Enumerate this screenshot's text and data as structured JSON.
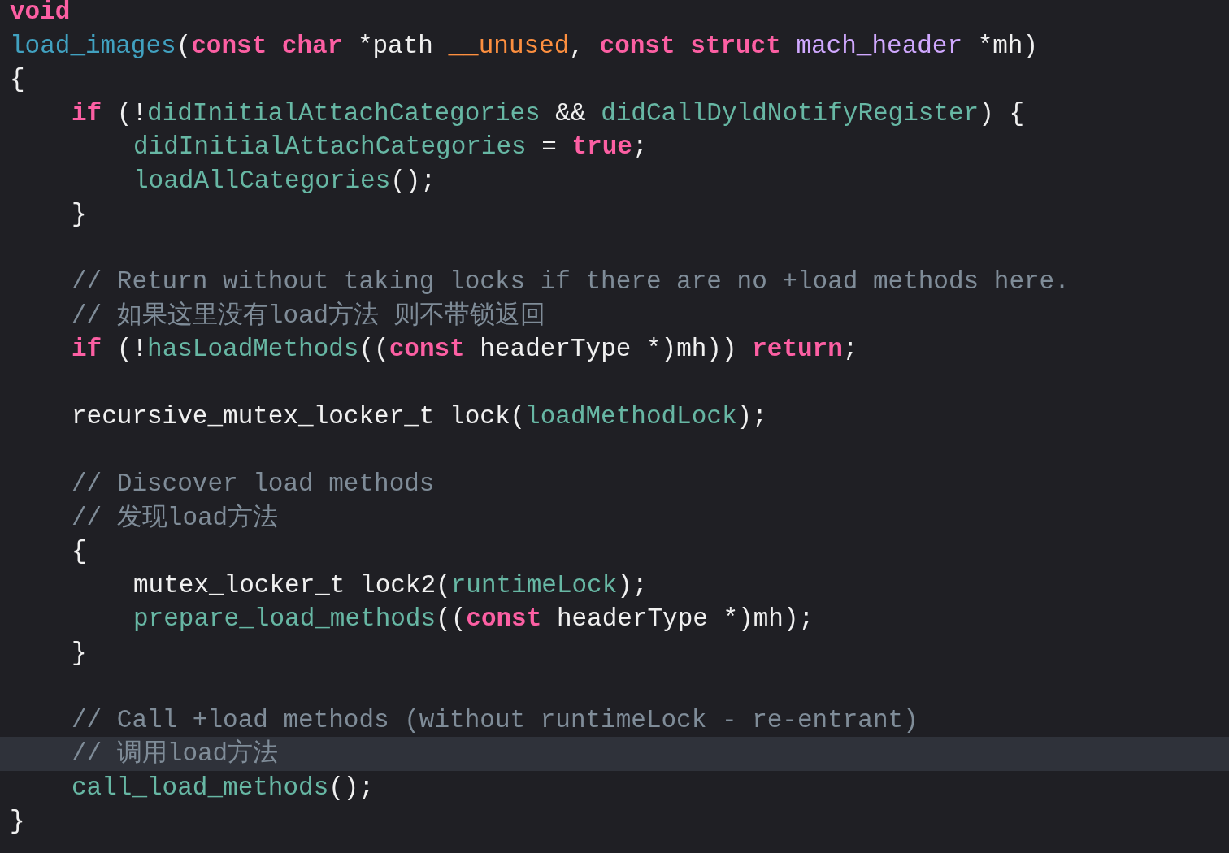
{
  "editor": {
    "lines": [
      {
        "kind": "code",
        "tokens": [
          {
            "text": "void",
            "kind": "keyword"
          }
        ]
      },
      {
        "kind": "code",
        "tokens": [
          {
            "text": "load_images",
            "kind": "declaration"
          },
          {
            "text": "(",
            "kind": "plain"
          },
          {
            "text": "const char",
            "kind": "keyword"
          },
          {
            "text": " *path ",
            "kind": "plain"
          },
          {
            "text": "__unused",
            "kind": "macro"
          },
          {
            "text": ", ",
            "kind": "plain"
          },
          {
            "text": "const struct ",
            "kind": "keyword"
          },
          {
            "text": "mach_header",
            "kind": "type"
          },
          {
            "text": " *mh)",
            "kind": "plain"
          }
        ]
      },
      {
        "kind": "code",
        "tokens": [
          {
            "text": "{",
            "kind": "plain"
          }
        ],
        "children": [
          {
            "kind": "code",
            "tokens": [
              {
                "text": "if",
                "kind": "keyword"
              },
              {
                "text": " (!",
                "kind": "plain"
              },
              {
                "text": "didInitialAttachCategories",
                "kind": "identifier"
              },
              {
                "text": " && ",
                "kind": "plain"
              },
              {
                "text": "didCallDyldNotifyRegister",
                "kind": "identifier"
              },
              {
                "text": ") {",
                "kind": "plain"
              }
            ],
            "children": [
              {
                "kind": "code",
                "tokens": [
                  {
                    "text": "didInitialAttachCategories",
                    "kind": "identifier"
                  },
                  {
                    "text": " = ",
                    "kind": "plain"
                  },
                  {
                    "text": "true",
                    "kind": "keyword"
                  },
                  {
                    "text": ";",
                    "kind": "plain"
                  }
                ]
              },
              {
                "kind": "code",
                "tokens": [
                  {
                    "text": "loadAllCategories",
                    "kind": "identifier"
                  },
                  {
                    "text": "();",
                    "kind": "plain"
                  }
                ]
              }
            ]
          },
          {
            "kind": "code",
            "tokens": [
              {
                "text": "}",
                "kind": "plain"
              }
            ]
          },
          {
            "kind": "blank"
          },
          {
            "kind": "code",
            "tokens": [
              {
                "text": "// Return without taking locks if there are no +load methods here.",
                "kind": "comment"
              }
            ]
          },
          {
            "kind": "code",
            "tokens": [
              {
                "text": "// 如果这里没有load方法 则不带锁返回",
                "kind": "comment"
              }
            ]
          },
          {
            "kind": "code",
            "tokens": [
              {
                "text": "if",
                "kind": "keyword"
              },
              {
                "text": " (!",
                "kind": "plain"
              },
              {
                "text": "hasLoadMethods",
                "kind": "identifier"
              },
              {
                "text": "((",
                "kind": "plain"
              },
              {
                "text": "const",
                "kind": "keyword"
              },
              {
                "text": " headerType *)mh)) ",
                "kind": "plain"
              },
              {
                "text": "return",
                "kind": "keyword"
              },
              {
                "text": ";",
                "kind": "plain"
              }
            ]
          },
          {
            "kind": "blank"
          },
          {
            "kind": "code",
            "tokens": [
              {
                "text": "recursive_mutex_locker_t lock(",
                "kind": "plain"
              },
              {
                "text": "loadMethodLock",
                "kind": "identifier"
              },
              {
                "text": ");",
                "kind": "plain"
              }
            ]
          },
          {
            "kind": "blank"
          },
          {
            "kind": "code",
            "tokens": [
              {
                "text": "// Discover load methods",
                "kind": "comment"
              }
            ]
          },
          {
            "kind": "code",
            "tokens": [
              {
                "text": "// 发现load方法",
                "kind": "comment"
              }
            ]
          },
          {
            "kind": "code",
            "tokens": [
              {
                "text": "{",
                "kind": "plain"
              }
            ],
            "children": [
              {
                "kind": "code",
                "tokens": [
                  {
                    "text": "mutex_locker_t lock2(",
                    "kind": "plain"
                  },
                  {
                    "text": "runtimeLock",
                    "kind": "identifier"
                  },
                  {
                    "text": ");",
                    "kind": "plain"
                  }
                ]
              },
              {
                "kind": "code",
                "tokens": [
                  {
                    "text": "prepare_load_methods",
                    "kind": "identifier"
                  },
                  {
                    "text": "((",
                    "kind": "plain"
                  },
                  {
                    "text": "const",
                    "kind": "keyword"
                  },
                  {
                    "text": " headerType *)mh);",
                    "kind": "plain"
                  }
                ]
              }
            ]
          },
          {
            "kind": "code",
            "tokens": [
              {
                "text": "}",
                "kind": "plain"
              }
            ]
          },
          {
            "kind": "blank"
          },
          {
            "kind": "code",
            "tokens": [
              {
                "text": "// Call +load methods (without runtimeLock - re-entrant)",
                "kind": "comment"
              }
            ]
          },
          {
            "kind": "code",
            "highlighted": true,
            "tokens": [
              {
                "text": "// 调用load方法",
                "kind": "comment"
              }
            ]
          },
          {
            "kind": "code",
            "tokens": [
              {
                "text": "call_load_methods",
                "kind": "identifier"
              },
              {
                "text": "();",
                "kind": "plain"
              }
            ]
          }
        ]
      },
      {
        "kind": "code",
        "tokens": [
          {
            "text": "}",
            "kind": "plain"
          }
        ]
      }
    ]
  }
}
